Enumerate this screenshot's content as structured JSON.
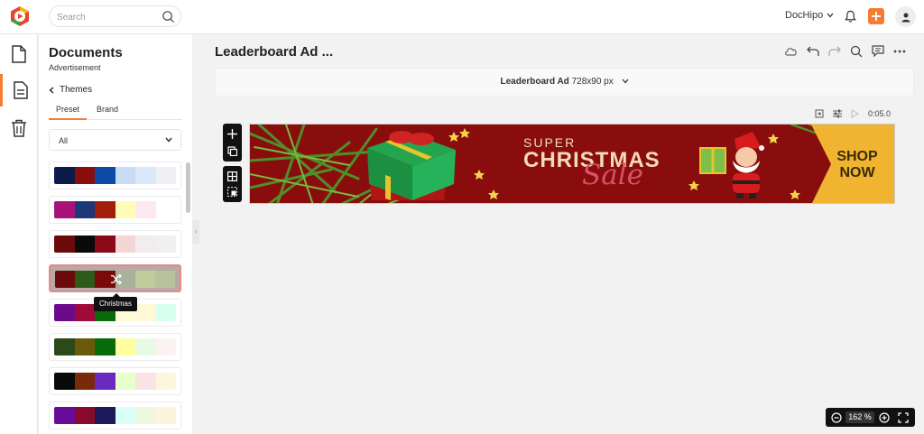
{
  "search": {
    "placeholder": "Search"
  },
  "header": {
    "brand_menu_label": "DocHipo"
  },
  "panel": {
    "title": "Documents",
    "subtitle": "Advertisement",
    "back_label": "Themes",
    "tabs": [
      {
        "label": "Preset"
      },
      {
        "label": "Brand"
      }
    ],
    "filter": {
      "selected": "All"
    }
  },
  "themes": [
    {
      "colors": [
        "#0d1b4a",
        "#8a0d0d",
        "#0b4aa5",
        "#c8ddf5",
        "#dbe9fa",
        "#eef0f3"
      ]
    },
    {
      "colors": [
        "#a8137a",
        "#1c3879",
        "#a11f0b",
        "#fffcb8",
        "#fde9f1",
        "#ffffff"
      ]
    },
    {
      "colors": [
        "#6b0a0a",
        "#0a0a0a",
        "#8a0a17",
        "#f5d6d6",
        "#f3ecec",
        "#f0f0f0"
      ]
    },
    {
      "colors": [
        "#6b0a0a",
        "#2e5a1a",
        "#7a0a0a",
        "#a8b19a",
        "#c2cc9a",
        "#b8c29a"
      ],
      "selected": true
    },
    {
      "colors": [
        "#6b0a8a",
        "#a00a3a",
        "#0a6b0a",
        "#fffbd6",
        "#fff8d6",
        "#d6fff0"
      ]
    },
    {
      "colors": [
        "#2a4a1a",
        "#6b5a0a",
        "#0a6b0a",
        "#ffffa0",
        "#e6fae6",
        "#fdf2f2"
      ]
    },
    {
      "colors": [
        "#0a0a0a",
        "#7a2a0a",
        "#6b2abf",
        "#e6ffcc",
        "#f9e3e3",
        "#fdf6dc"
      ]
    },
    {
      "colors": [
        "#6b0a9a",
        "#8a0a2a",
        "#1a1a5a",
        "#d8fff8",
        "#eef8e0",
        "#fdf4dc"
      ]
    }
  ],
  "tooltip": {
    "label": "Christmas"
  },
  "document": {
    "title": "Leaderboard Ad ...",
    "size_name": "Leaderboard Ad",
    "size_dims": "728x90 px"
  },
  "timeline": {
    "duration": "0:05.0"
  },
  "banner": {
    "super": "SUPER",
    "christmas": "CHRISTMAS",
    "sale": "Sale",
    "cta": "SHOP NOW",
    "background": "#8a0d0d",
    "cta_color": "#f0b430"
  },
  "zoom": {
    "value": "162 %"
  },
  "colors": {
    "accent": "#f47d31"
  }
}
